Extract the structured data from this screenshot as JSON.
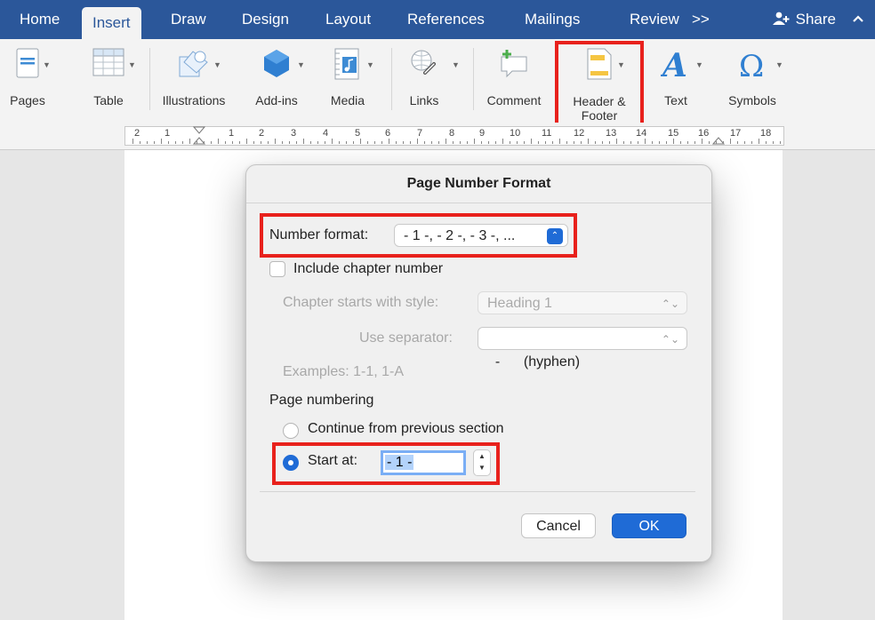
{
  "tabs": [
    "Home",
    "Insert",
    "Draw",
    "Design",
    "Layout",
    "References",
    "Mailings",
    "Review",
    ">>"
  ],
  "active_tab": "Insert",
  "share_label": "Share",
  "ribbon": {
    "pages": "Pages",
    "table": "Table",
    "illustrations": "Illustrations",
    "addins": "Add-ins",
    "media": "Media",
    "links": "Links",
    "comment": "Comment",
    "header_footer": "Header & Footer",
    "text": "Text",
    "symbols": "Symbols"
  },
  "ruler_numbers": [
    "2",
    "1",
    "1",
    "2",
    "3",
    "4",
    "5",
    "6",
    "7",
    "8",
    "9",
    "10",
    "11",
    "12",
    "13",
    "14",
    "15",
    "16",
    "17",
    "18"
  ],
  "dialog": {
    "title": "Page Number Format",
    "number_format_label": "Number format:",
    "number_format_value": "- 1 -, - 2 -, - 3 -, ...",
    "include_chapter_label": "Include chapter number",
    "chapter_style_label": "Chapter starts with style:",
    "chapter_style_value": "Heading 1",
    "separator_label": "Use separator:",
    "separator_value": "-      (hyphen)",
    "examples_label": "Examples: 1-1, 1-A",
    "page_numbering_label": "Page numbering",
    "continue_label": "Continue from previous section",
    "start_at_label": "Start at:",
    "start_at_value": "- 1 -",
    "cancel_label": "Cancel",
    "ok_label": "OK"
  },
  "colors": {
    "word_blue": "#2b579a",
    "highlight_red": "#e8211c",
    "accent_blue": "#1f6bd6"
  },
  "icons": [
    "pages-icon",
    "table-icon",
    "illustrations-icon",
    "addins-icon",
    "media-icon",
    "links-icon",
    "comment-icon",
    "header-footer-icon",
    "text-icon",
    "symbols-icon",
    "share-person-icon",
    "collapse-chevron-icon"
  ]
}
